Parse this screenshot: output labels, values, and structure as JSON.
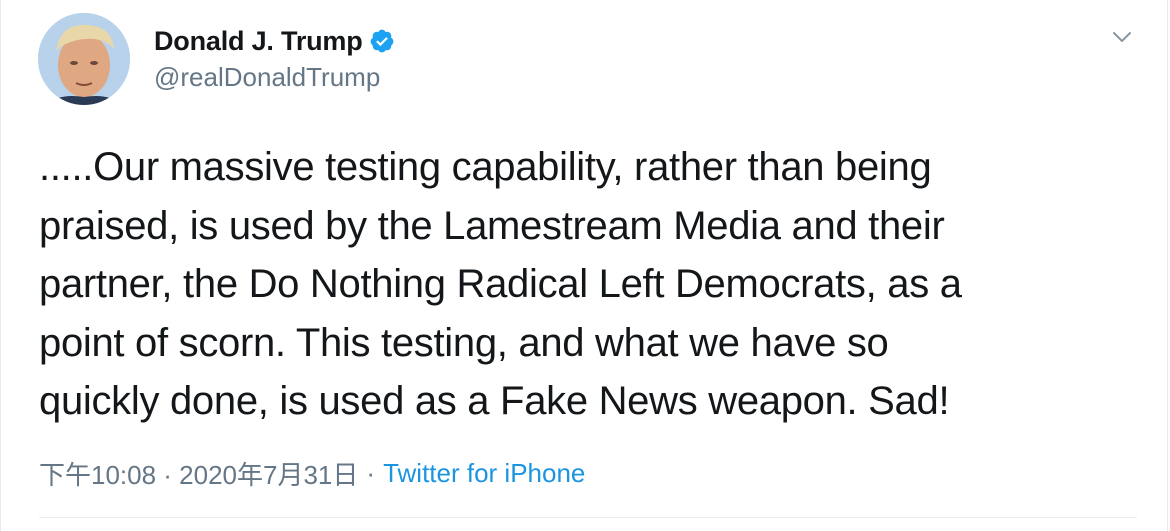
{
  "tweet": {
    "author": {
      "display_name": "Donald J. Trump",
      "handle": "@realDonaldTrump",
      "verified_icon": "verified-badge-icon"
    },
    "text_lines": [
      ".....Our massive testing capability, rather than being",
      "praised, is used by the Lamestream Media and their",
      "partner, the Do Nothing Radical Left Democrats, as a",
      "point of scorn. This testing, and what we have so",
      "quickly done, is used as a Fake News weapon. Sad!"
    ],
    "timestamp": "下午10:08 · 2020年7月31日",
    "separator": "·",
    "source": "Twitter for iPhone",
    "menu_icon": "chevron-down-icon"
  },
  "colors": {
    "text": "#14171a",
    "secondary": "#657786",
    "link": "#1b95e0",
    "verified": "#1da1f2"
  }
}
